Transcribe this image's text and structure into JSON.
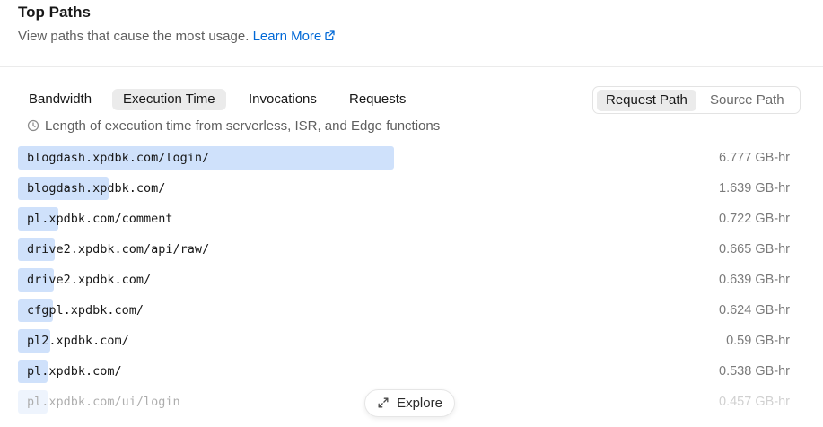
{
  "header": {
    "title": "Top Paths",
    "subtitle": "View paths that cause the most usage.",
    "learn_more": "Learn More"
  },
  "metric_tabs": [
    {
      "label": "Bandwidth",
      "active": false
    },
    {
      "label": "Execution Time",
      "active": true
    },
    {
      "label": "Invocations",
      "active": false
    },
    {
      "label": "Requests",
      "active": false
    }
  ],
  "path_toggle": {
    "request_path": "Request Path",
    "source_path": "Source Path",
    "selected": "Request Path"
  },
  "description": "Length of execution time from serverless, ISR, and Edge functions",
  "rows": [
    {
      "path": "blogdash.xpdbk.com/login/",
      "value": "6.777 GB-hr",
      "amount": 6.777
    },
    {
      "path": "blogdash.xpdbk.com/",
      "value": "1.639 GB-hr",
      "amount": 1.639
    },
    {
      "path": "pl.xpdbk.com/comment",
      "value": "0.722 GB-hr",
      "amount": 0.722
    },
    {
      "path": "drive2.xpdbk.com/api/raw/",
      "value": "0.665 GB-hr",
      "amount": 0.665
    },
    {
      "path": "drive2.xpdbk.com/",
      "value": "0.639 GB-hr",
      "amount": 0.639
    },
    {
      "path": "cfgpl.xpdbk.com/",
      "value": "0.624 GB-hr",
      "amount": 0.624
    },
    {
      "path": "pl2.xpdbk.com/",
      "value": "0.59 GB-hr",
      "amount": 0.59
    },
    {
      "path": "pl.xpdbk.com/",
      "value": "0.538 GB-hr",
      "amount": 0.538
    },
    {
      "path": "pl.xpdbk.com/ui/login",
      "value": "0.457 GB-hr",
      "amount": 0.457
    }
  ],
  "explore_button": "Explore",
  "colors": {
    "bar": "#cfe1fb",
    "link": "#0068d6",
    "active_tab_bg": "#ebebeb"
  }
}
